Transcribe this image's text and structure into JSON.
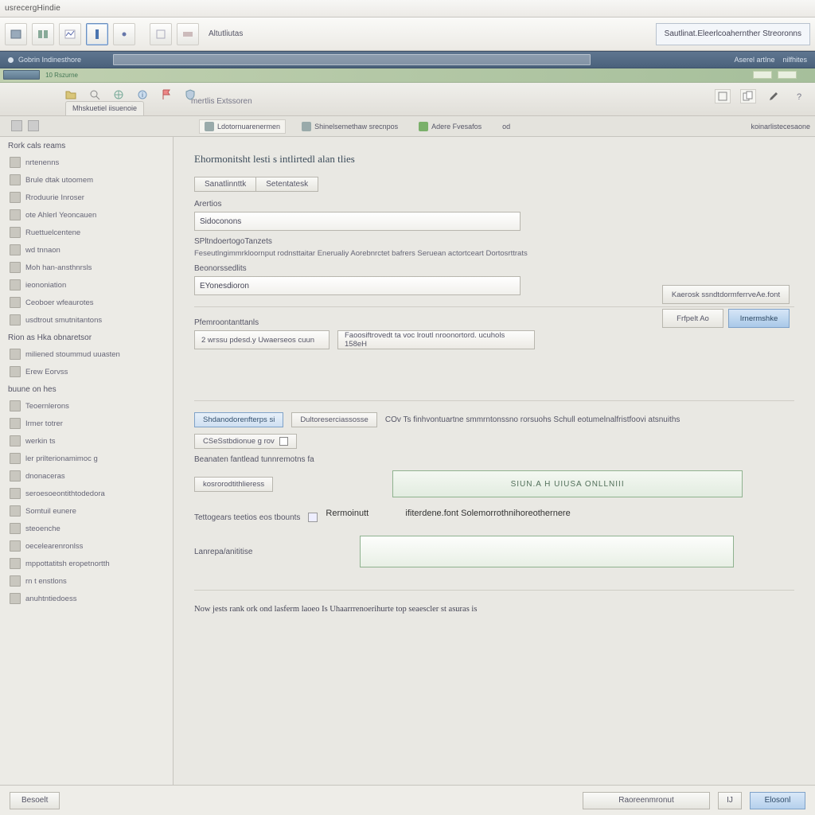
{
  "titlebar": {
    "title": "usrecergHindie"
  },
  "toolbar": {
    "label": "Altutliutas",
    "right_label": "Sautlinat.Eleerlcoahernther Streoronns"
  },
  "subheader": {
    "left": "Gobrin Indinesthore",
    "right1": "Aserel artIne",
    "right2": "nilfhites"
  },
  "accent": {
    "chip_label": "10 Rszurne"
  },
  "childchrome": {
    "label": "mertlis Extssoren",
    "tab1": "Mhskuetiel iisuenoie"
  },
  "secbar": {
    "b1": "Ldotornuarenermen",
    "b2": "Shinelsemethaw srecnpos",
    "b3": "Adere Fvesafos",
    "b4": "od",
    "b5": "koinarlistecesaone"
  },
  "sidebar": {
    "sec1": "Rork cals reams",
    "sec1_items": [
      "nrtenenns",
      "Brule dtak utoomem",
      "Rroduurie Inroser",
      "ote Ahlerl Yeoncauen",
      "Ruettuelcentene",
      "wd tnnaon",
      "Moh han-ansthnrsls",
      "ieononiation",
      "Ceoboer wfeaurotes",
      "usdtrout smutnitantons"
    ],
    "sec2": "Rion as Hka obnaretsor",
    "sec2_items": [
      "miliened stoummud uuasten",
      "Erew Eorvss"
    ],
    "sec3": "buune on hes",
    "sec3_items": [
      "Teoernlerons",
      "Irmer totrer",
      "werkin ts",
      "ler prilterionamimoc g",
      "dnonaceras",
      "seroesoeontithtodedora",
      "Somtuil eunere",
      "steoenche",
      "oecelearenronlss",
      "mppottatitsh eropetnortth",
      "rn t enstlons",
      "anuhtntiedoess"
    ]
  },
  "content": {
    "heading": "Ehormonitsht lesti s intlirtedl alan tlies",
    "tab_a": "Sanatlinnttk",
    "tab_b": "Setentatesk",
    "label1": "Arertios",
    "input1": "Sidoconons",
    "label2": "SPltndoertogoTanzets",
    "desc2": "Feseutlngimmrkloornput rodnsttaitar Enerualiy Aorebnrctet bafrers Seruean actortceart Dortosrttrats",
    "label3": "Beonorssedlits",
    "input3": "EYonesdioron",
    "label4": "Pfemroontanttanls",
    "sel4a": "2 wrssu pdesd.y Uwaerseos cuun",
    "sel4b": "Faoosiftrovedt ta voc lroutl nroonortord. ucuhols 158eH",
    "chip_blue": "Shdanodorenfterps si",
    "chip_plain": "Dultoreserciassosse",
    "chk_label": "CSeSstbdionue g rov",
    "note": "COv Ts finhvontuartne smmrntonssno rorsuohs Schull eotumelnalfristfoovi atsnuiths",
    "label5": "Beanaten fantlead tunnremotns fa",
    "chip_left": "kosrorodtithlieress",
    "bigbox1": "SIUN.A   H UIUSA ONLLNIII",
    "label6": "Tettogears teetios eos tbounts",
    "sel6a": "Rermoinutt",
    "sel6b": "ifiterdene.font Solemorrothnihoreothernere",
    "label7": "Lanrepa/anititise",
    "longdesc": "Now jests rank ork ond lasferm laoeo Is Uhaarrrenoerihurte top seaescler st asuras is"
  },
  "rightpanel": {
    "btn1": "Kaerosk ssndtdormferrveAe.font",
    "btn2a": "Frfpelt Ao",
    "btn2b": "Irnermshke"
  },
  "footer": {
    "left": "Besoelt",
    "mid": "Raoreenmronut",
    "small": "IJ",
    "right": "Elosonl"
  }
}
